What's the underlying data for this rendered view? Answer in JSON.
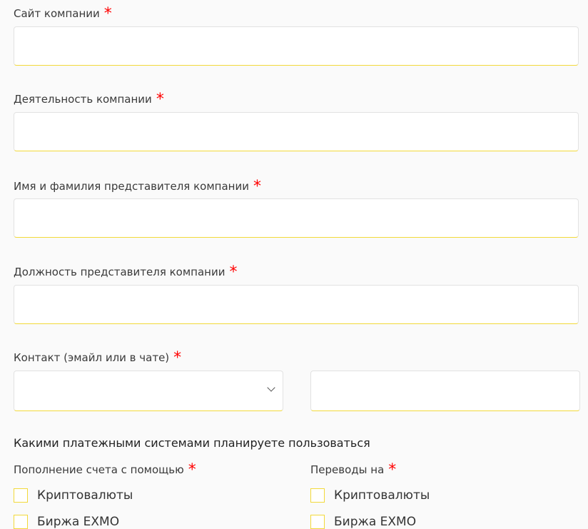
{
  "fields": [
    {
      "label": "Сайт компании",
      "required": "*"
    },
    {
      "label": "Деятельность компании",
      "required": "*"
    },
    {
      "label": "Имя и фамилия представителя компании",
      "required": "*"
    },
    {
      "label": "Должность представителя компании",
      "required": "*"
    },
    {
      "label": "Контакт (эмайл или в чате)",
      "required": "*"
    }
  ],
  "payments": {
    "heading": "Какими платежными системами планируете пользоваться",
    "deposit": {
      "label": "Пополнение счета с помощью",
      "required": "*",
      "options": [
        "Криптовалюты",
        "Биржа EXMO"
      ]
    },
    "transfer": {
      "label": "Переводы на",
      "required": "*",
      "options": [
        "Криптовалюты",
        "Биржа EXMO"
      ]
    }
  },
  "colors": {
    "accent": "#f2d93a",
    "required": "#ff0000"
  }
}
